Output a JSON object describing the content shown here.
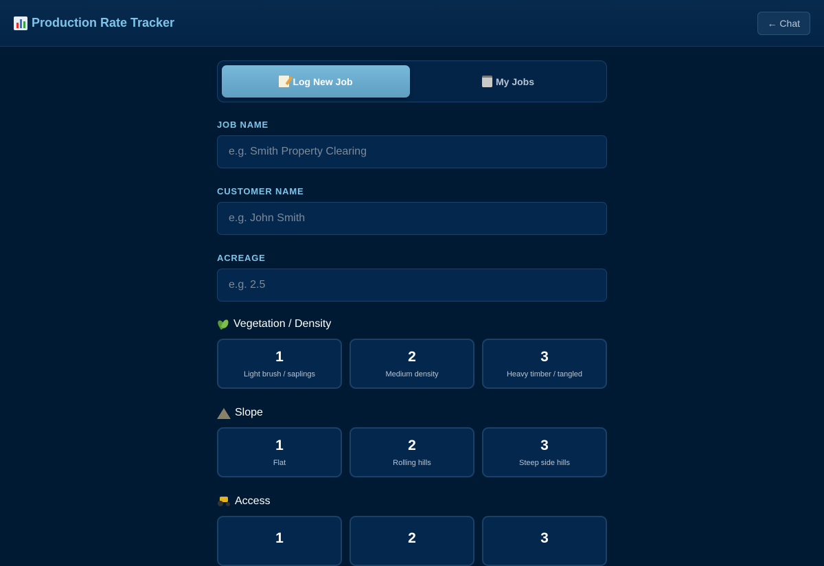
{
  "header": {
    "title": "Production Rate Tracker",
    "chat_button": "← Chat"
  },
  "tabs": [
    {
      "label": "Log New Job",
      "active": true
    },
    {
      "label": "My Jobs",
      "active": false
    }
  ],
  "form": {
    "job_name": {
      "label": "JOB NAME",
      "placeholder": "e.g. Smith Property Clearing"
    },
    "customer_name": {
      "label": "CUSTOMER NAME",
      "placeholder": "e.g. John Smith"
    },
    "acreage": {
      "label": "ACREAGE",
      "placeholder": "e.g. 2.5"
    }
  },
  "sections": {
    "vegetation": {
      "title": "Vegetation / Density",
      "icon": "leaf-icon",
      "options": [
        {
          "num": "1",
          "desc": "Light brush / saplings"
        },
        {
          "num": "2",
          "desc": "Medium density"
        },
        {
          "num": "3",
          "desc": "Heavy timber / tangled"
        }
      ]
    },
    "slope": {
      "title": "Slope",
      "icon": "mountain-icon",
      "options": [
        {
          "num": "1",
          "desc": "Flat"
        },
        {
          "num": "2",
          "desc": "Rolling hills"
        },
        {
          "num": "3",
          "desc": "Steep side hills"
        }
      ]
    },
    "access": {
      "title": "Access",
      "icon": "tractor-icon",
      "options": [
        {
          "num": "1",
          "desc": ""
        },
        {
          "num": "2",
          "desc": ""
        },
        {
          "num": "3",
          "desc": ""
        }
      ]
    }
  },
  "colors": {
    "background": "#001a33",
    "accent": "#7ec3e8",
    "active_tab": "#6aaccf"
  }
}
